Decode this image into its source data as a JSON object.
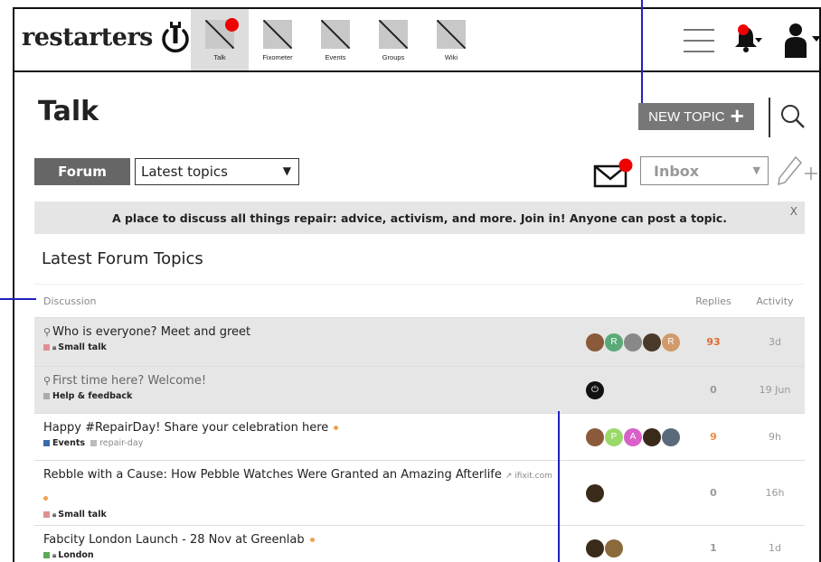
{
  "brand": {
    "name": "restarters"
  },
  "nav": {
    "items": [
      {
        "label": "Talk",
        "active": true,
        "notify": true
      },
      {
        "label": "Fixometer",
        "active": false,
        "notify": false
      },
      {
        "label": "Events",
        "active": false,
        "notify": false
      },
      {
        "label": "Groups",
        "active": false,
        "notify": false
      },
      {
        "label": "Wiki",
        "active": false,
        "notify": false
      }
    ]
  },
  "page": {
    "title": "Talk"
  },
  "actions": {
    "new_topic_label": "NEW TOPIC"
  },
  "filters": {
    "forum_label": "Forum",
    "topic_select_value": "Latest topics",
    "inbox_select_value": "Inbox"
  },
  "banner": {
    "text": "A place to discuss all things repair: advice, activism, and more. Join in! Anyone can post a topic.",
    "close": "X"
  },
  "section": {
    "title": "Latest Forum Topics"
  },
  "table": {
    "columns": {
      "discussion": "Discussion",
      "replies": "Replies",
      "activity": "Activity"
    },
    "rows": [
      {
        "title": "Who is everyone? Meet and greet",
        "pinned": true,
        "muted": false,
        "new": false,
        "link": "",
        "category": "Small talk",
        "category_color": "#e09090",
        "locked": true,
        "tags": [],
        "avatars": [
          {
            "letter": "",
            "color": "#8a5a3a"
          },
          {
            "letter": "R",
            "color": "#5aaa78"
          },
          {
            "letter": "",
            "color": "#888888"
          },
          {
            "letter": "",
            "color": "#4a3a2a"
          },
          {
            "letter": "R",
            "color": "#d09a6a"
          }
        ],
        "replies": "93",
        "replies_color": "#e06a30",
        "activity": "3d"
      },
      {
        "title": "First time here? Welcome!",
        "pinned": true,
        "muted": true,
        "new": false,
        "link": "",
        "category": "Help & feedback",
        "category_color": "#aaaaaa",
        "locked": false,
        "tags": [],
        "avatars": [
          {
            "letter": "⏻",
            "color": "#111111"
          }
        ],
        "replies": "0",
        "replies_color": "#999999",
        "activity": "19 Jun"
      },
      {
        "title": "Happy #RepairDay! Share your celebration here",
        "pinned": false,
        "muted": false,
        "new": true,
        "link": "",
        "category": "Events",
        "category_color": "#3a6ab0",
        "locked": false,
        "tags": [
          "repair-day"
        ],
        "avatars": [
          {
            "letter": "",
            "color": "#8a5a3a"
          },
          {
            "letter": "P",
            "color": "#9ad86a"
          },
          {
            "letter": "A",
            "color": "#d860c8"
          },
          {
            "letter": "",
            "color": "#3a2a1a"
          },
          {
            "letter": "",
            "color": "#5a6a7a"
          }
        ],
        "replies": "9",
        "replies_color": "#f08a3a",
        "activity": "9h"
      },
      {
        "title": "Rebble with a Cause: How Pebble Watches Were Granted an Amazing Afterlife",
        "pinned": false,
        "muted": false,
        "new": true,
        "link": "ifixit.com",
        "category": "Small talk",
        "category_color": "#e09090",
        "locked": true,
        "tags": [],
        "avatars": [
          {
            "letter": "",
            "color": "#3a2a1a"
          }
        ],
        "replies": "0",
        "replies_color": "#999999",
        "activity": "16h"
      },
      {
        "title": "Fabcity London Launch - 28 Nov at Greenlab",
        "pinned": false,
        "muted": false,
        "new": true,
        "link": "",
        "category": "London",
        "category_color": "#5aaa5a",
        "locked": true,
        "tags": [],
        "avatars": [
          {
            "letter": "",
            "color": "#3a2a1a"
          },
          {
            "letter": "",
            "color": "#8a6a3a"
          }
        ],
        "replies": "1",
        "replies_color": "#999999",
        "activity": "1d"
      }
    ]
  }
}
